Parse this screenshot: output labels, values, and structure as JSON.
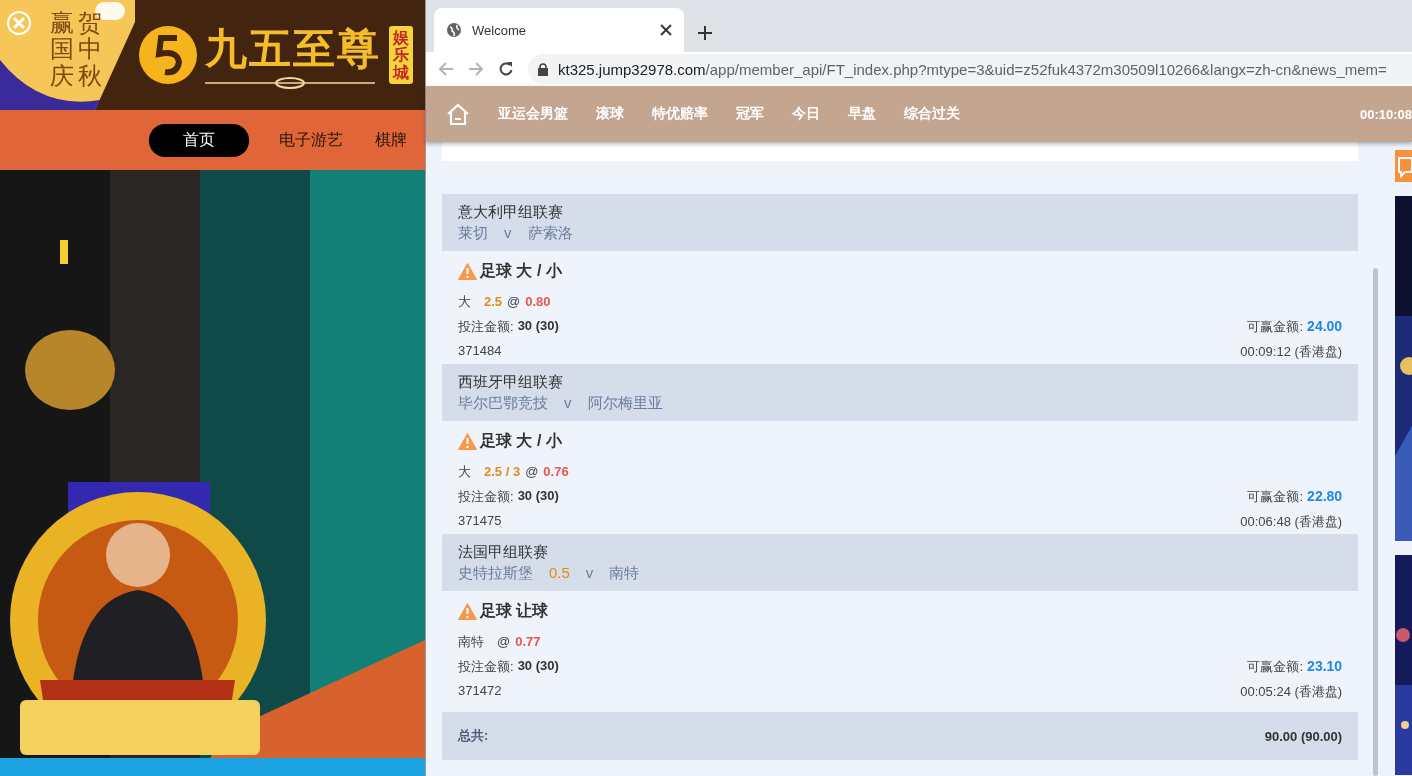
{
  "ad_panel": {
    "slogan_columns": [
      "赢国庆",
      "贺中秋"
    ],
    "brand": "九五至尊",
    "brand_tag": "娱乐城",
    "nav": [
      {
        "label": "首页",
        "selected": true
      },
      {
        "label": "电子游艺",
        "selected": false
      },
      {
        "label": "棋牌",
        "selected": false
      }
    ],
    "promo": {
      "kind": "picture"
    }
  },
  "browser": {
    "tab": {
      "title": "Welcome"
    },
    "url_host": "kt325.jump32978.com",
    "url_path": "/app/member_api/FT_index.php?mtype=3&uid=z52fuk4372m30509l10266&langx=zh-cn&news_mem="
  },
  "site_nav": {
    "items": [
      "亚运会男篮",
      "滚球",
      "特优赔率",
      "冠军",
      "今日",
      "早盘",
      "综合过关"
    ],
    "clock": "00:10:08"
  },
  "bets": [
    {
      "league": "意大利甲组联赛",
      "home": "莱切",
      "versus": "v",
      "away": "萨索洛",
      "market": "足球 大 / 小",
      "pick": "大",
      "line": "2.5",
      "at": "@",
      "odds": "0.80",
      "stake_label": "投注金额:",
      "stake": "30 (30)",
      "win_label": "可赢金额:",
      "win": "24.00",
      "ticket": "371484",
      "time": "00:09:12 (香港盘)"
    },
    {
      "league": "西班牙甲组联赛",
      "home": "毕尔巴鄂竞技",
      "versus": "v",
      "away": "阿尔梅里亚",
      "market": "足球 大 / 小",
      "pick": "大",
      "line": "2.5 / 3",
      "at": "@",
      "odds": "0.76",
      "stake_label": "投注金额:",
      "stake": "30 (30)",
      "win_label": "可赢金额:",
      "win": "22.80",
      "ticket": "371475",
      "time": "00:06:48 (香港盘)"
    },
    {
      "league": "法国甲组联赛",
      "home": "史特拉斯堡",
      "handicap": "0.5",
      "versus": "v",
      "away": "南特",
      "market": "足球 让球",
      "pick": "南特",
      "at": "@",
      "odds": "0.77",
      "stake_label": "投注金额:",
      "stake": "30 (30)",
      "win_label": "可赢金额:",
      "win": "23.10",
      "ticket": "371472",
      "time": "00:05:24 (香港盘)"
    }
  ],
  "total": {
    "label": "总共:",
    "value": "90.00 (90.00)"
  }
}
